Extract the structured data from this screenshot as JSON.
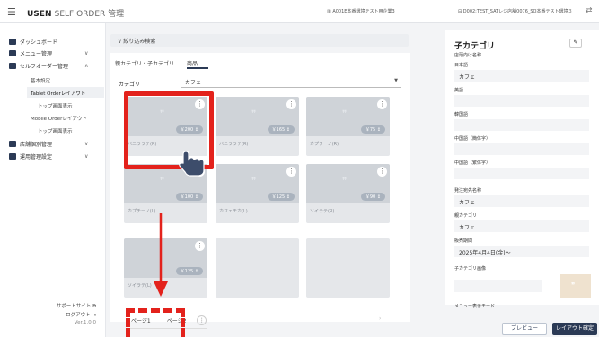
{
  "header": {
    "brand": "USEN",
    "product": "SELF ORDER 管理",
    "store_selector": "A001E本番環境テスト用企業3",
    "terminal_selector": "D002:TEST_SATレジ店舗0076_SO本番テスト環境３",
    "menu_icon": "hamburger-icon",
    "swap_icon": "swap-icon"
  },
  "sidebar": {
    "items": [
      {
        "label": "ダッシュボード",
        "icon": "dashboard-icon"
      },
      {
        "label": "メニュー管理",
        "icon": "menu-icon",
        "chevron": "∨"
      },
      {
        "label": "セルフオーダー管理",
        "icon": "tablet-icon",
        "chevron": "∧"
      },
      {
        "label": "店舗個別管理",
        "icon": "store-icon",
        "chevron": "∨"
      },
      {
        "label": "運用管理設定",
        "icon": "settings-icon",
        "chevron": "∨"
      }
    ],
    "subitems": [
      "基本設定",
      "Tablet Orderレイアウト",
      "トップ画面表示",
      "Mobile Orderレイアウト",
      "トップ画面表示"
    ],
    "footer": {
      "support": "サポートサイト",
      "logout": "ログアウト",
      "version": "Ver.1.0.0"
    }
  },
  "main": {
    "filter_label": "絞り込み検索",
    "tabs": [
      "親カテゴリ・子カテゴリ",
      "商品"
    ],
    "category_label": "カテゴリ",
    "category_value": "カフェ",
    "products": [
      {
        "name": "バニララテ(R)",
        "price": "￥200"
      },
      {
        "name": "バニララテ(R)",
        "price": "￥165"
      },
      {
        "name": "カプチーノ(R)",
        "price": "￥75"
      },
      {
        "name": "カプチーノ(L)",
        "price": "￥100"
      },
      {
        "name": "カフェモカ(L)",
        "price": "￥125"
      },
      {
        "name": "ソイラテ(R)",
        "price": "￥90"
      },
      {
        "name": "ソイラテ(L)",
        "price": "￥125"
      },
      {
        "name": "",
        "price": ""
      },
      {
        "name": "",
        "price": ""
      }
    ],
    "pages": [
      "ページ1",
      "ページ2"
    ],
    "kebab": "⋮"
  },
  "detail": {
    "title": "子カテゴリ",
    "edit_icon": "pencil-icon",
    "fields": [
      {
        "label": "店頭向け名称",
        "value": ""
      },
      {
        "label": "日本語",
        "value": "カフェ"
      },
      {
        "label": "英語",
        "value": ""
      },
      {
        "label": "韓国語",
        "value": ""
      },
      {
        "label": "中国語（簡体字）",
        "value": ""
      },
      {
        "label": "中国語（繁体字）",
        "value": ""
      },
      {
        "label": "発注宛先名称",
        "value": "カフェ"
      },
      {
        "label": "親カテゴリ",
        "value": "カフェ"
      },
      {
        "label": "販売期間",
        "value": "2025年4月4日(金)〜"
      },
      {
        "label": "子カテゴリ画像",
        "value": ""
      },
      {
        "label": "メニュー表示モード",
        "value": ""
      }
    ]
  },
  "buttons": {
    "preview": "プレビュー",
    "confirm": "レイアウト確定"
  },
  "colors": {
    "navy": "#2b3a55",
    "highlight": "#e3221c"
  }
}
